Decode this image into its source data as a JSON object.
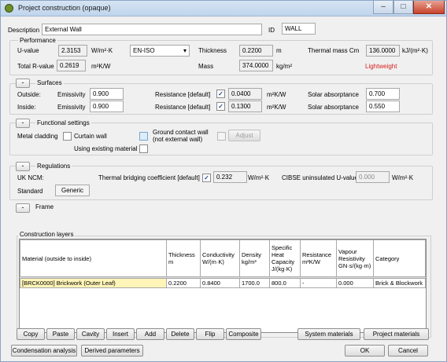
{
  "window": {
    "title": "Project construction (opaque)",
    "controls": {
      "minimize": "–",
      "maximize": "□",
      "close": "✕"
    }
  },
  "header": {
    "description_label": "Description",
    "description_value": "External Wall",
    "id_label": "ID",
    "id_value": "WALL"
  },
  "performance": {
    "title": "Performance",
    "u_value_label": "U-value",
    "u_value": "2.3153",
    "u_value_unit": "W/m²·K",
    "standard_select": "EN-ISO",
    "thickness_label": "Thickness",
    "thickness_value": "0.2200",
    "thickness_unit": "m",
    "thermal_mass_label": "Thermal mass Cm",
    "thermal_mass_value": "136.0000",
    "thermal_mass_unit": "kJ/(m²·K)",
    "total_r_label": "Total R-value",
    "total_r_value": "0.2619",
    "total_r_unit": "m²K/W",
    "mass_label": "Mass",
    "mass_value": "374.0000",
    "mass_unit": "kg/m²",
    "weight_class": "Lightweight"
  },
  "surfaces": {
    "collapse": "-",
    "title": "Surfaces",
    "outside_label": "Outside:",
    "inside_label": "Inside:",
    "emissivity_label": "Emissivity",
    "outside_emissivity": "0.900",
    "inside_emissivity": "0.900",
    "resistance_label": "Resistance [default]",
    "outside_resistance": "0.0400",
    "inside_resistance": "0.1300",
    "resistance_unit": "m²K/W",
    "solar_label": "Solar absorptance",
    "outside_solar": "0.700",
    "inside_solar": "0.550",
    "check_mark": "✓"
  },
  "functional": {
    "collapse": "-",
    "title": "Functional settings",
    "metal_cladding_label": "Metal cladding",
    "curtain_wall_label": "Curtain wall",
    "ground_contact_label_1": "Ground contact wall",
    "ground_contact_label_2": "(not external wall)",
    "adjust_button": "Adjust",
    "existing_material_label": "Using existing material"
  },
  "regulations": {
    "collapse": "-",
    "title": "Regulations",
    "uk_ncm_label": "UK NCM:",
    "thermal_bridging_label": "Thermal bridging coefficient [default]",
    "thermal_bridging_value": "0.232",
    "thermal_bridging_unit": "W/m²·K",
    "cibse_label": "CIBSE uninsulated U-value",
    "cibse_value": "0.000",
    "cibse_unit": "W/m²·K",
    "standard_label": "Standard",
    "standard_value": "Generic",
    "check_mark": "✓"
  },
  "frame": {
    "collapse": "-",
    "title": "Frame"
  },
  "layers": {
    "title": "Construction layers",
    "headers": [
      [
        "Material (outside to inside)"
      ],
      [
        "Thickness",
        "m"
      ],
      [
        "Conductivity",
        "W/(m·K)"
      ],
      [
        "Density",
        "kg/m³"
      ],
      [
        "Specific",
        "Heat",
        "Capacity",
        "J/(kg·K)"
      ],
      [
        "Resistance",
        "m²K/W"
      ],
      [
        "Vapour",
        "Resistivity",
        "GN·s/(kg·m)"
      ],
      [
        "Category"
      ]
    ],
    "rows": [
      [
        "[BRCK0000] Brickwork (Outer Leaf)",
        "0.2200",
        "0.8400",
        "1700.0",
        "800.0",
        "-",
        "0.000",
        "Brick & Blockwork"
      ]
    ]
  },
  "buttons": {
    "copy": "Copy",
    "paste": "Paste",
    "cavity": "Cavity",
    "insert": "Insert",
    "add": "Add",
    "delete": "Delete",
    "flip": "Flip",
    "composite": "Composite",
    "system_materials": "System materials",
    "project_materials": "Project materials",
    "condensation": "Condensation analysis",
    "derived": "Derived parameters",
    "ok": "OK",
    "cancel": "Cancel"
  }
}
